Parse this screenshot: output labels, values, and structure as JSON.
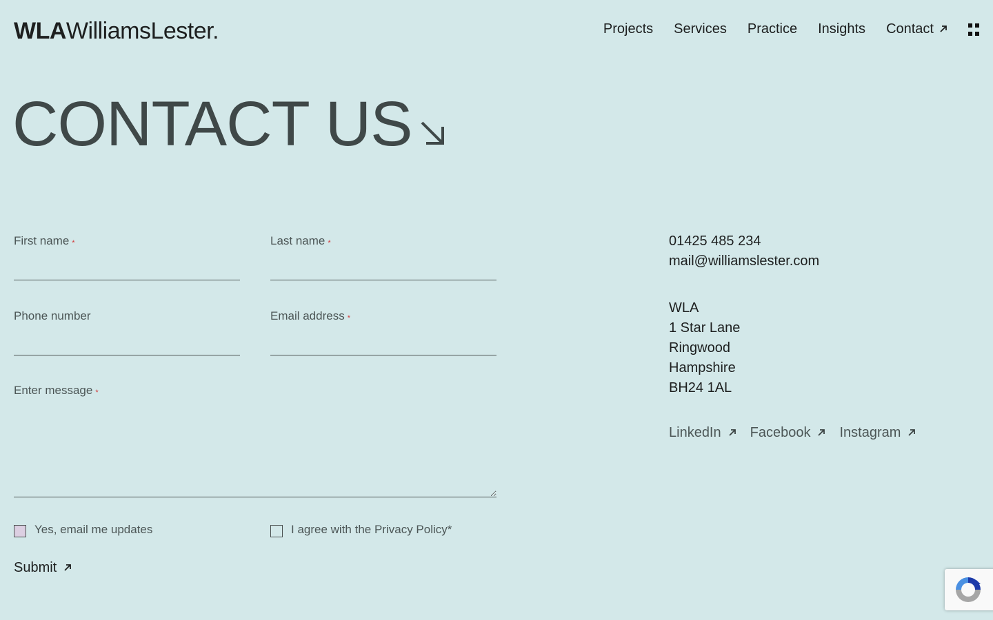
{
  "header": {
    "logo_mark": "WLA",
    "logo_name": "WilliamsLester.",
    "nav": [
      {
        "label": "Projects"
      },
      {
        "label": "Services"
      },
      {
        "label": "Practice"
      },
      {
        "label": "Insights"
      },
      {
        "label": "Contact"
      }
    ],
    "menu_icon": "grid-icon"
  },
  "title": "CONTACT US",
  "form": {
    "first_name": {
      "label": "First name",
      "required": "*",
      "value": ""
    },
    "last_name": {
      "label": "Last name",
      "required": "*",
      "value": ""
    },
    "phone": {
      "label": "Phone number",
      "value": ""
    },
    "email": {
      "label": "Email address",
      "required": "*",
      "value": ""
    },
    "message": {
      "label": "Enter message",
      "required": "*",
      "value": ""
    },
    "updates_checkbox": {
      "label": "Yes, email me updates",
      "checked": false
    },
    "privacy_checkbox": {
      "label": "I agree with the Privacy Policy*",
      "checked": false
    },
    "submit_label": "Submit"
  },
  "contact": {
    "phone": "01425 485 234",
    "email": "mail@williamslester.com",
    "address": [
      "WLA",
      "1 Star Lane",
      "Ringwood",
      "Hampshire",
      "BH24 1AL"
    ]
  },
  "socials": [
    {
      "label": "LinkedIn"
    },
    {
      "label": "Facebook"
    },
    {
      "label": "Instagram"
    }
  ],
  "colors": {
    "background": "#d3e8e9",
    "text": "#1d1f1f",
    "title": "#3f4848",
    "muted": "#4c5656",
    "required": "#d23b3b"
  }
}
